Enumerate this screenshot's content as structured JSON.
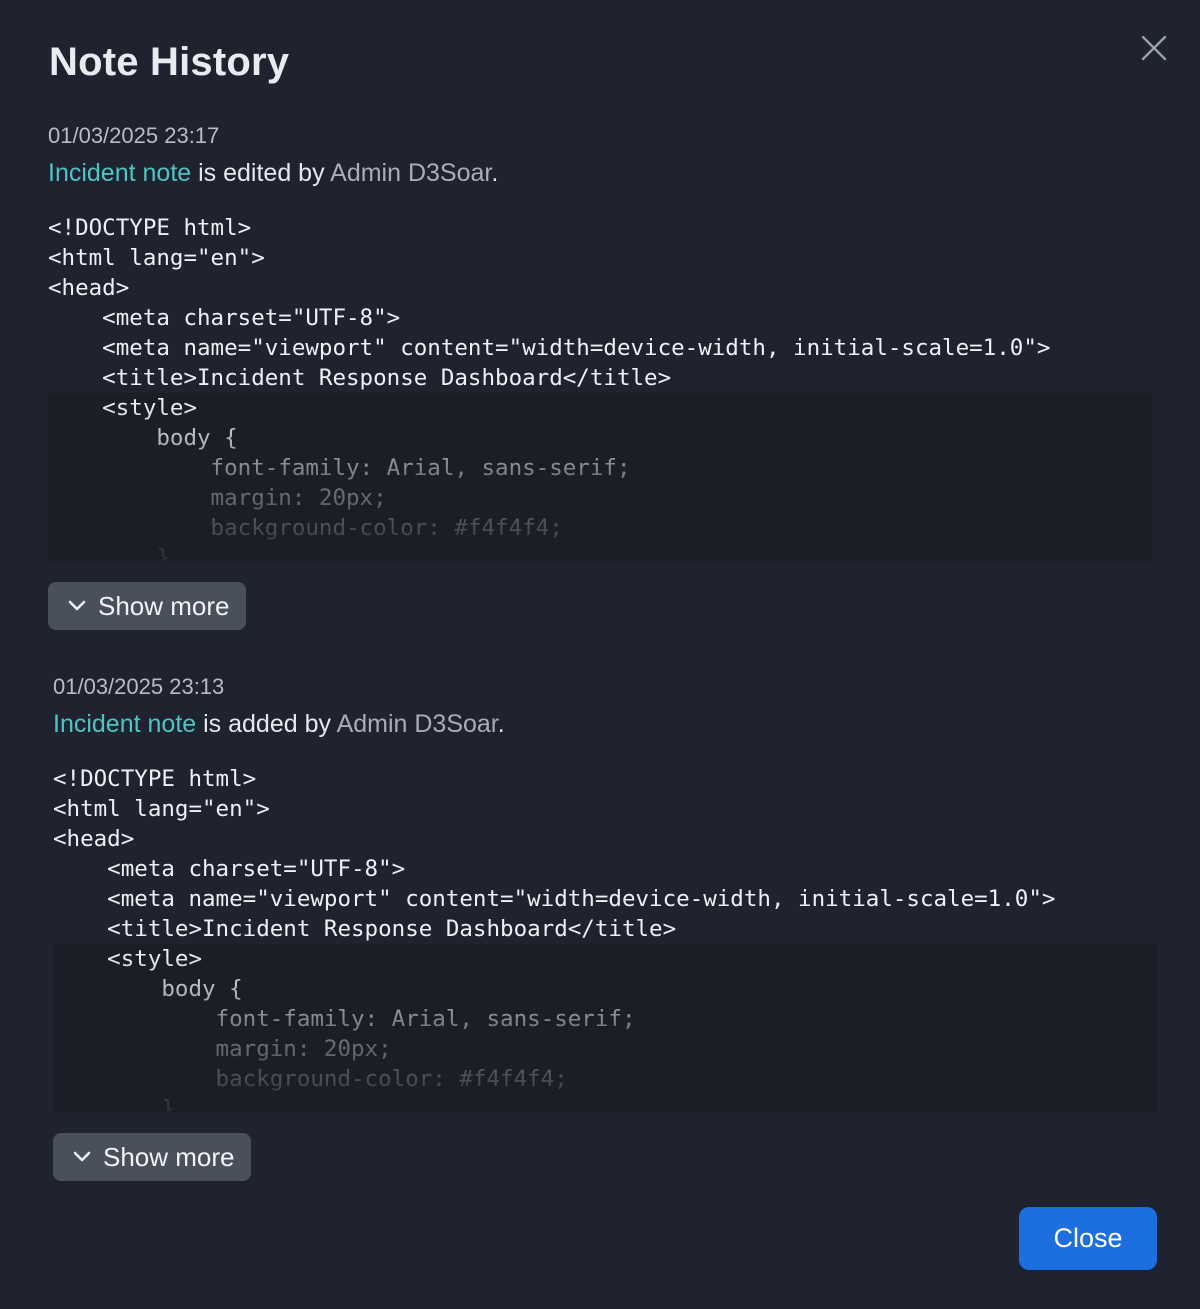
{
  "dialog": {
    "title": "Note History",
    "close_label": "Close"
  },
  "entries": [
    {
      "timestamp": "01/03/2025 23:17",
      "subject": "Incident note",
      "action": " is edited by ",
      "actor": "Admin D3Soar",
      "suffix": ".",
      "code": "<!DOCTYPE html>\n<html lang=\"en\">\n<head>\n    <meta charset=\"UTF-8\">\n    <meta name=\"viewport\" content=\"width=device-width, initial-scale=1.0\">\n    <title>Incident Response Dashboard</title>\n    <style>\n        body {\n            font-family: Arial, sans-serif;\n            margin: 20px;\n            background-color: #f4f4f4;\n        }",
      "show_more_label": "Show more"
    },
    {
      "timestamp": "01/03/2025 23:13",
      "subject": "Incident note",
      "action": " is added by ",
      "actor": "Admin D3Soar",
      "suffix": ".",
      "code": "<!DOCTYPE html>\n<html lang=\"en\">\n<head>\n    <meta charset=\"UTF-8\">\n    <meta name=\"viewport\" content=\"width=device-width, initial-scale=1.0\">\n    <title>Incident Response Dashboard</title>\n    <style>\n        body {\n            font-family: Arial, sans-serif;\n            margin: 20px;\n            background-color: #f4f4f4;\n        }",
      "show_more_label": "Show more"
    }
  ],
  "icons": {
    "close": "close-icon",
    "expand": "chevron-down-icon"
  },
  "colors": {
    "background": "#1f2330",
    "link": "#4fc4c4",
    "primary_button": "#1d6fe0",
    "secondary_button": "#4a4f5c"
  }
}
